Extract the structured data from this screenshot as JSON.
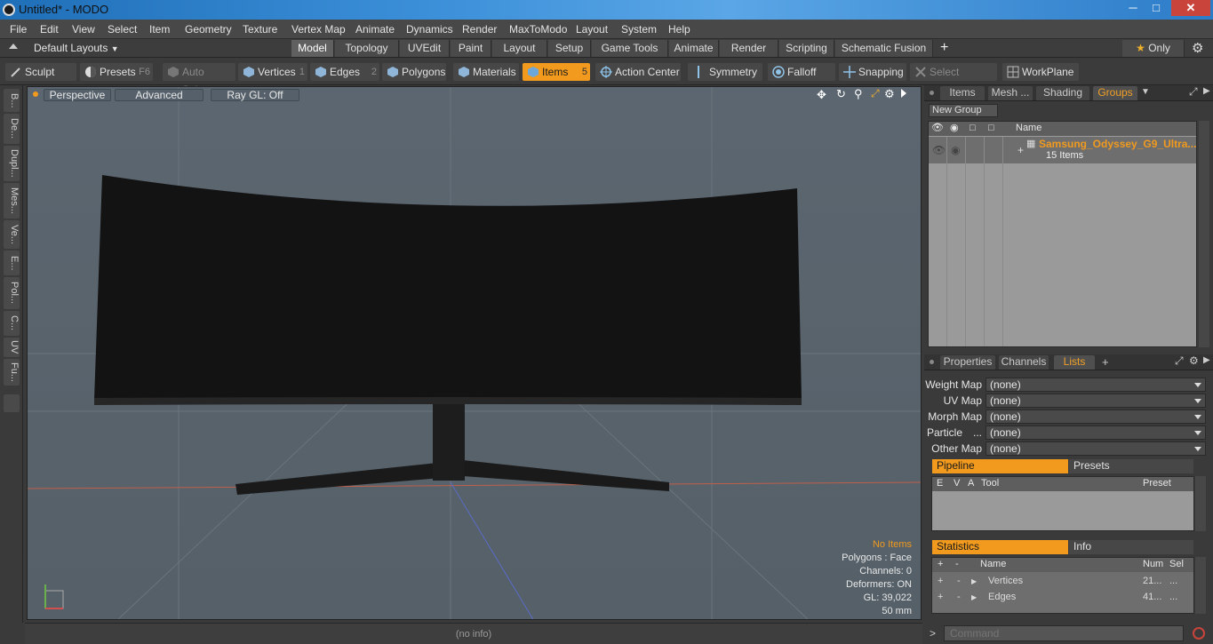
{
  "window": {
    "title": "Untitled* - MODO",
    "minimize": "─",
    "maximize": "□",
    "close": "✕"
  },
  "menu": [
    "File",
    "Edit",
    "View",
    "Select",
    "Item",
    "Geometry",
    "Texture",
    "Vertex Map",
    "Animate",
    "Dynamics",
    "Render",
    "MaxToModo",
    "Layout",
    "System",
    "Help"
  ],
  "layouts": {
    "default_label": "Default Layouts",
    "tabs": [
      "Model",
      "Topology",
      "UVEdit",
      "Paint",
      "Layout",
      "Setup",
      "Game Tools",
      "Animate",
      "Render",
      "Scripting",
      "Schematic Fusion"
    ],
    "active_tab": "Model",
    "add": "+",
    "only_label": "Only"
  },
  "toolbar": {
    "sculpt": "Sculpt",
    "presets": "Presets",
    "presets_key": "F6",
    "auto_select": "Auto Select",
    "vertices": "Vertices",
    "vertices_key": "1",
    "edges": "Edges",
    "edges_key": "2",
    "polygons": "Polygons",
    "materials": "Materials",
    "items": "Items",
    "items_key": "5",
    "action_center": "Action Center",
    "symmetry": "Symmetry",
    "falloff": "Falloff",
    "snapping": "Snapping",
    "select_through": "Select Through",
    "workplane": "WorkPlane"
  },
  "left_tabs": [
    "B...",
    "De...",
    "Dupl...",
    "Mes...",
    "Ve...",
    "E...",
    "Pol...",
    "C...",
    "UV",
    "Fu..."
  ],
  "viewport": {
    "perspective": "Perspective",
    "advanced": "Advanced",
    "raygl": "Ray GL: Off",
    "hud": {
      "items": "No Items",
      "polygons": "Polygons : Face",
      "channels": "Channels: 0",
      "deformers": "Deformers: ON",
      "gl": "GL: 39,022",
      "size": "50 mm"
    }
  },
  "items_panel": {
    "tabs": [
      "Items",
      "Mesh ...",
      "Shading",
      "Groups"
    ],
    "active_tab": "Groups",
    "new_group": "New Group",
    "column_name": "Name",
    "group_name": "Samsung_Odyssey_G9_Ultra...",
    "group_count": "15 Items"
  },
  "props_panel": {
    "tabs": [
      "Properties",
      "Channels",
      "Lists"
    ],
    "active_tab": "Lists",
    "add": "+",
    "fields": [
      {
        "label": "Weight Map",
        "value": "(none)"
      },
      {
        "label": "UV Map",
        "value": "(none)"
      },
      {
        "label": "Morph Map",
        "value": "(none)"
      },
      {
        "label": "Particle",
        "value": "(none)"
      },
      {
        "label": "Other Map",
        "value": "(none)"
      }
    ],
    "particle_ellipsis": "...",
    "pipeline": "Pipeline",
    "presets": "Presets",
    "pipe_cols": [
      "E",
      "V",
      "A",
      "Tool",
      "Preset"
    ],
    "statistics": "Statistics",
    "info": "Info",
    "stat_cols": [
      "+",
      "-",
      "Name",
      "Num",
      "Sel"
    ],
    "stat_rows": [
      {
        "name": "Vertices",
        "num": "21...",
        "sel": "..."
      },
      {
        "name": "Edges",
        "num": "41...",
        "sel": "..."
      }
    ]
  },
  "status": {
    "info": "(no info)",
    "command_placeholder": "Command",
    "prompt": ">"
  },
  "colors": {
    "accent": "#f19a1e",
    "viewport_bg": "#5a646d",
    "monitor": "#121212"
  }
}
